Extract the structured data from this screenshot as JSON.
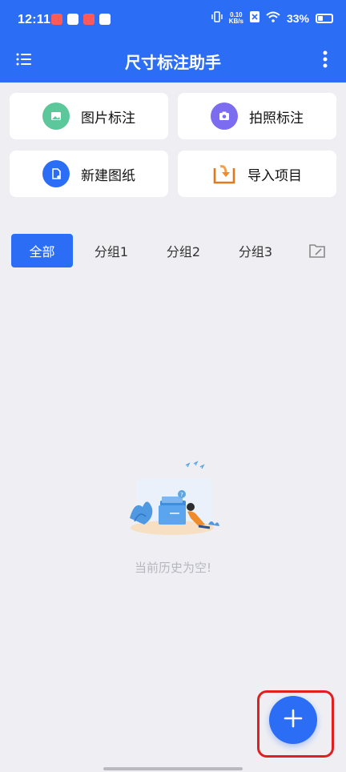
{
  "status_bar": {
    "time": "12:11",
    "net_speed_top": "0.10",
    "net_speed_bottom": "KB/s",
    "battery": "33%"
  },
  "header": {
    "title": "尺寸标注助手"
  },
  "actions": [
    {
      "label": "图片标注",
      "icon": "image-icon",
      "color": "#5cc79a"
    },
    {
      "label": "拍照标注",
      "icon": "camera-icon",
      "color": "#7b6cf0"
    },
    {
      "label": "新建图纸",
      "icon": "new-file-icon",
      "color": "#2b6ef5"
    },
    {
      "label": "导入项目",
      "icon": "import-icon",
      "color": "#f08b2c"
    }
  ],
  "tabs": [
    {
      "label": "全部",
      "active": true
    },
    {
      "label": "分组1",
      "active": false
    },
    {
      "label": "分组2",
      "active": false
    },
    {
      "label": "分组3",
      "active": false
    }
  ],
  "empty_state": {
    "message": "当前历史为空!"
  },
  "colors": {
    "primary": "#2b6ef5",
    "background": "#efeff3",
    "highlight": "#e02020"
  }
}
